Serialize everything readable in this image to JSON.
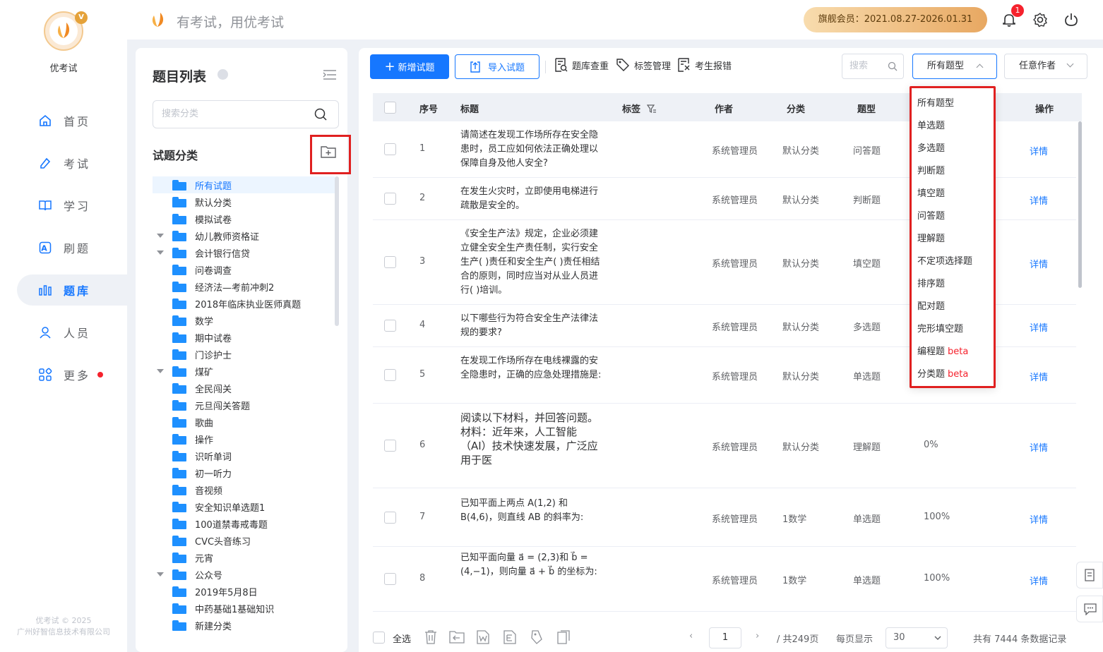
{
  "app": {
    "name": "优考试",
    "slogan": "有考试，用优考试",
    "copyright_line1": "优考试 © 2025",
    "copyright_line2": "广州好智信息技术有限公司"
  },
  "nav": [
    {
      "label": "首页",
      "icon": "home-icon"
    },
    {
      "label": "考试",
      "icon": "exam-icon"
    },
    {
      "label": "学习",
      "icon": "book-icon"
    },
    {
      "label": "刷题",
      "icon": "practice-icon"
    },
    {
      "label": "题库",
      "icon": "bank-icon",
      "active": true
    },
    {
      "label": "人员",
      "icon": "user-icon"
    },
    {
      "label": "更多",
      "icon": "more-icon",
      "dot": true
    }
  ],
  "topbar": {
    "vip": "旗舰会员：2021.08.27-2026.01.31",
    "notifications": "1"
  },
  "left_panel": {
    "title": "题目列表",
    "search_placeholder": "搜索分类",
    "category_title": "试题分类",
    "tree": [
      {
        "label": "所有试题",
        "active": true,
        "caret": false
      },
      {
        "label": "默认分类",
        "caret": false
      },
      {
        "label": "模拟试卷",
        "caret": false
      },
      {
        "label": "幼儿教师资格证",
        "caret": true
      },
      {
        "label": "会计银行信贷",
        "caret": true
      },
      {
        "label": "问卷调查",
        "caret": false
      },
      {
        "label": "经济法—考前冲刺2",
        "caret": false
      },
      {
        "label": "2018年临床执业医师真题",
        "caret": false
      },
      {
        "label": "数学",
        "caret": false
      },
      {
        "label": "期中试卷",
        "caret": false
      },
      {
        "label": "门诊护士",
        "caret": false
      },
      {
        "label": "煤矿",
        "caret": true
      },
      {
        "label": "全民闯关",
        "caret": false
      },
      {
        "label": "元旦闯关答题",
        "caret": false
      },
      {
        "label": "歌曲",
        "caret": false
      },
      {
        "label": "操作",
        "caret": false
      },
      {
        "label": "识听单词",
        "caret": false
      },
      {
        "label": "初一听力",
        "caret": false
      },
      {
        "label": "音视频",
        "caret": false
      },
      {
        "label": "安全知识单选题1",
        "caret": false
      },
      {
        "label": "100道禁毒戒毒题",
        "caret": false
      },
      {
        "label": "CVC头音练习",
        "caret": false
      },
      {
        "label": "元宵",
        "caret": false
      },
      {
        "label": "公众号",
        "caret": true
      },
      {
        "label": "2019年5月8日",
        "caret": false
      },
      {
        "label": "中药基础1基础知识",
        "caret": false
      },
      {
        "label": "新建分类",
        "caret": false
      }
    ]
  },
  "toolbar": {
    "add": "新增试题",
    "import": "导入试题",
    "dup": "题库查重",
    "tags": "标签管理",
    "report": "考生报错",
    "search_placeholder": "搜索",
    "type_select": "所有题型",
    "author_select": "任意作者"
  },
  "table": {
    "headers": {
      "index": "序号",
      "title": "标题",
      "tag": "标签",
      "author": "作者",
      "category": "分类",
      "type": "题型",
      "action": "操作"
    },
    "rows": [
      {
        "index": "1",
        "title": "请简述在发现工作场所存在安全隐患时，员工应如何依法正确处理以保障自身及他人安全?",
        "author": "系统管理员",
        "category": "默认分类",
        "type": "问答题",
        "rate": "",
        "action": "详情"
      },
      {
        "index": "2",
        "title": "在发生火灾时，立即使用电梯进行疏散是安全的。",
        "author": "系统管理员",
        "category": "默认分类",
        "type": "判断题",
        "rate": "",
        "action": "详情"
      },
      {
        "index": "3",
        "title": "《安全生产法》规定，企业必须建立健全安全生产责任制，实行安全生产(  )责任和安全生产(  )责任相结合的原则，同时应当对从业人员进行(  )培训。",
        "author": "系统管理员",
        "category": "默认分类",
        "type": "填空题",
        "rate": "",
        "action": "详情"
      },
      {
        "index": "4",
        "title": "以下哪些行为符合安全生产法律法规的要求?",
        "author": "系统管理员",
        "category": "默认分类",
        "type": "多选题",
        "rate": "",
        "action": "详情"
      },
      {
        "index": "5",
        "title": "在发现工作场所存在电线裸露的安全隐患时，正确的应急处理措施是:",
        "author": "系统管理员",
        "category": "默认分类",
        "type": "单选题",
        "rate": "",
        "action": "详情"
      },
      {
        "index": "6",
        "title": "阅读以下材料，并回答问题。材料：近年来，人工智能（AI）技术快速发展，广泛应用于医",
        "author": "系统管理员",
        "category": "默认分类",
        "type": "理解题",
        "rate": "0%",
        "action": "详情"
      },
      {
        "index": "7",
        "title": "已知平面上两点 A(1,2) 和 B(4,6)，则直线 AB 的斜率为:",
        "author": "系统管理员",
        "category": "1数学",
        "type": "单选题",
        "rate": "100%",
        "action": "详情"
      },
      {
        "index": "8",
        "title": "已知平面向量 a⃗ = (2,3)和 b⃗ = (4,−1)，则向量 a⃗ + b⃗ 的坐标为:",
        "author": "系统管理员",
        "category": "1数学",
        "type": "单选题",
        "rate": "100%",
        "action": "详情"
      }
    ]
  },
  "dropdown": [
    {
      "label": "所有题型"
    },
    {
      "label": "单选题"
    },
    {
      "label": "多选题"
    },
    {
      "label": "判断题"
    },
    {
      "label": "填空题"
    },
    {
      "label": "问答题"
    },
    {
      "label": "理解题"
    },
    {
      "label": "不定项选择题"
    },
    {
      "label": "排序题"
    },
    {
      "label": "配对题"
    },
    {
      "label": "完形填空题"
    },
    {
      "label": "编程题",
      "beta": "beta"
    },
    {
      "label": "分类题",
      "beta": "beta"
    }
  ],
  "footer": {
    "select_all": "全选",
    "page": "1",
    "total_pages": "/ 共249页",
    "per_page_label": "每页显示",
    "per_page": "30",
    "total": "共有 7444 条数据记录"
  },
  "colors": {
    "primary": "#1677ff",
    "highlight_box": "#e02020",
    "folder": "#1e90ff"
  }
}
